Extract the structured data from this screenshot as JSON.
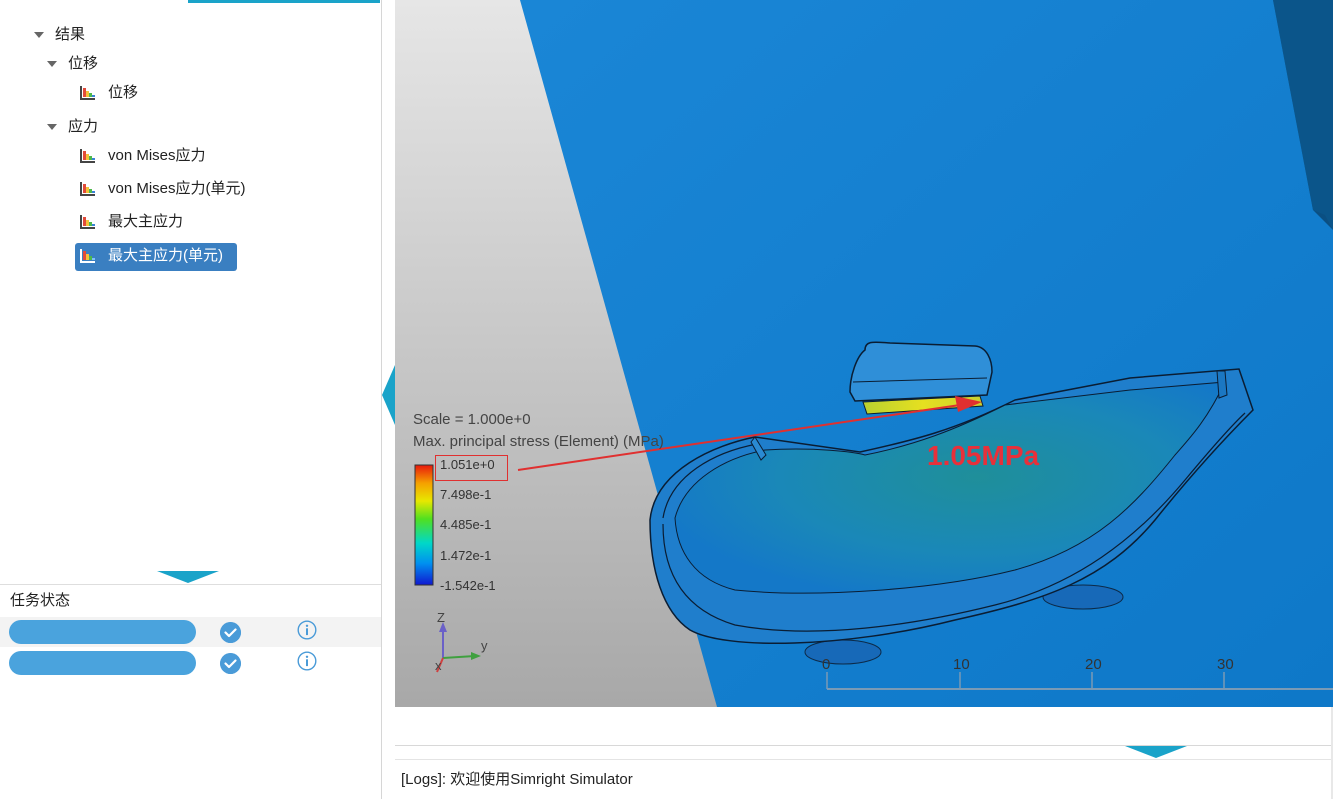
{
  "tree": {
    "root_label": "结果",
    "groups": [
      {
        "label": "位移",
        "items": [
          "位移"
        ]
      },
      {
        "label": "应力",
        "items": [
          "von Mises应力",
          "von Mises应力(单元)",
          "最大主应力",
          "最大主应力(单元)"
        ]
      }
    ],
    "selected": "最大主应力(单元)"
  },
  "task_status": {
    "title": "任务状态",
    "rows": [
      {
        "status_icon": "check-circle-icon",
        "info_icon": "info-icon"
      },
      {
        "status_icon": "check-circle-icon",
        "info_icon": "info-icon"
      }
    ]
  },
  "viewport": {
    "scale_text": "Scale = 1.000e+0",
    "legend_title": "Max. principal stress (Element) (MPa)",
    "legend_ticks": [
      "1.051e+0",
      "7.498e-1",
      "4.485e-1",
      "1.472e-1",
      "-1.542e-1"
    ],
    "callout": "1.05MPa",
    "ruler_labels": [
      "0",
      "10",
      "20",
      "30"
    ],
    "axes": {
      "z": "Z",
      "y": "y",
      "x": "x"
    },
    "colors": {
      "background_model": "#1180d0",
      "callout": "#e8303a",
      "accent": "#1aa3c9",
      "selection": "#3a7fc1"
    }
  },
  "logs": {
    "text": "[Logs]: 欢迎使用Simright Simulator"
  }
}
